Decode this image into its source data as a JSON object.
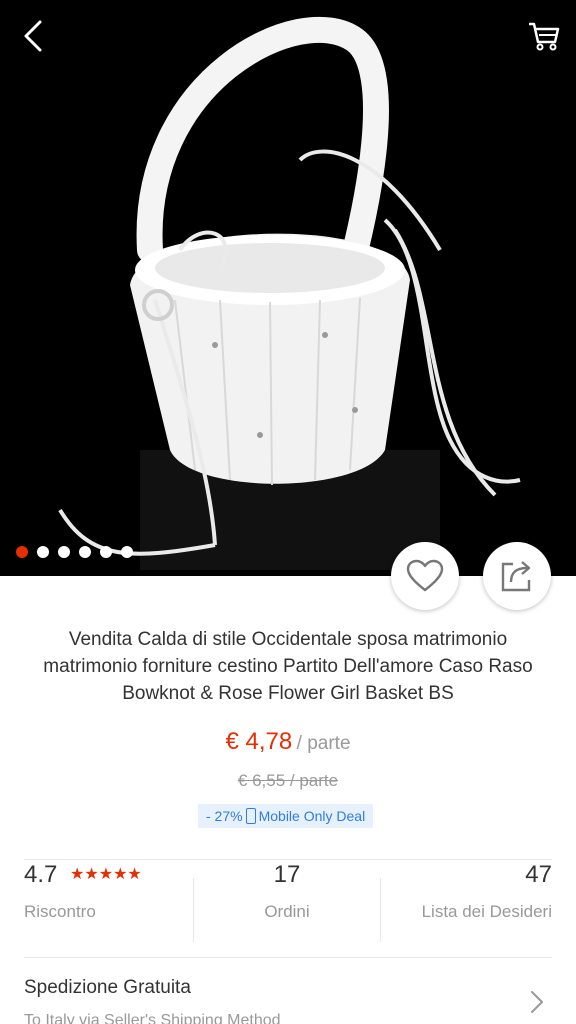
{
  "product": {
    "title": "Vendita Calda di stile Occidentale sposa matrimonio matrimonio forniture cestino Partito Dell'amore Caso Raso Bowknot & Rose Flower Girl Basket BS",
    "price": "€ 4,78",
    "price_unit": "/ parte",
    "old_price": "€ 6,55  / parte",
    "discount": "- 27%",
    "deal_label": "Mobile Only Deal",
    "accent_color": "#e62e04"
  },
  "gallery": {
    "image_count": 6,
    "active_index": 0
  },
  "stats": {
    "rating": "4.7",
    "rating_stars": 4.7,
    "rating_label": "Riscontro",
    "orders": "17",
    "orders_label": "Ordini",
    "wishlist": "47",
    "wishlist_label": "Lista dei Desideri"
  },
  "shipping": {
    "title": "Spedizione Gratuita",
    "subtitle": "To Italy via Seller's Shipping Method"
  },
  "icons": {
    "back": "chevron-left-icon",
    "cart": "cart-icon",
    "wishlist": "heart-icon",
    "share": "share-icon",
    "forward": "chevron-right-icon"
  }
}
